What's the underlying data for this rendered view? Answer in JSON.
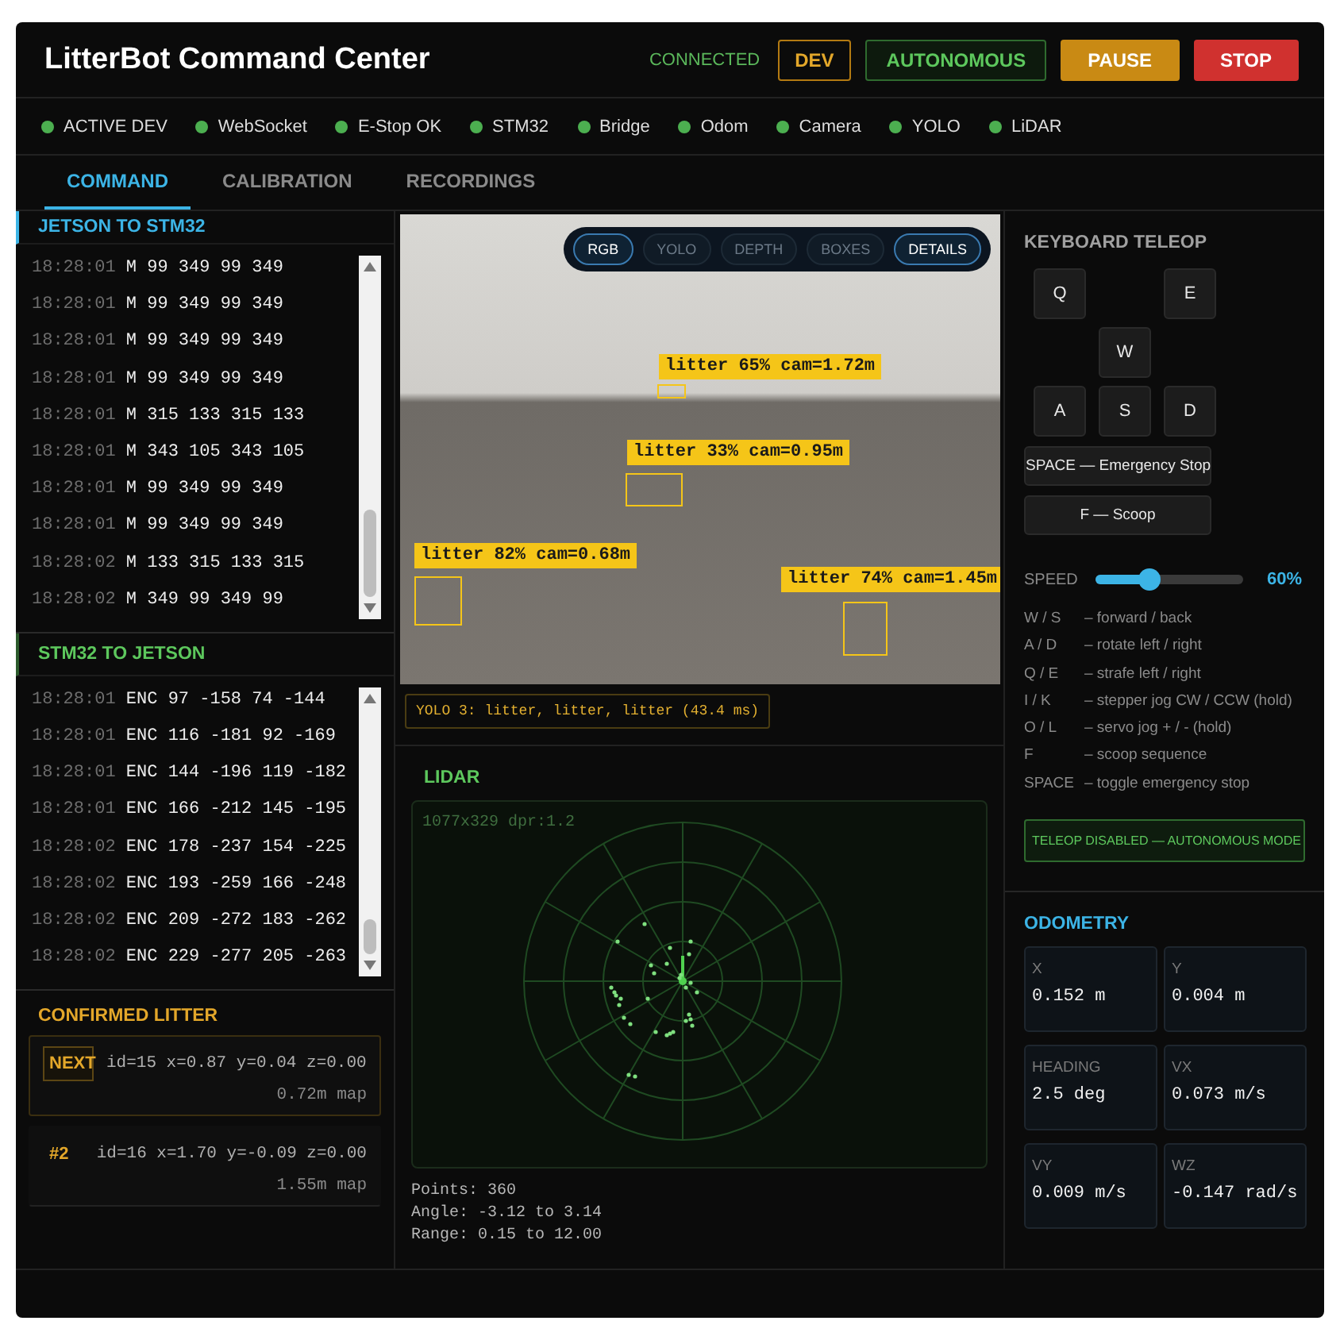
{
  "header": {
    "title": "LitterBot Command Center",
    "connection": "CONNECTED",
    "buttons": [
      {
        "label": "DEV",
        "kind": "outline-amber"
      },
      {
        "label": "AUTONOMOUS",
        "kind": "outline-green"
      },
      {
        "label": "PAUSE",
        "kind": "fill-amber"
      },
      {
        "label": "STOP",
        "kind": "fill-red"
      }
    ]
  },
  "status_bar": [
    {
      "label": "ACTIVE DEV",
      "ok": true
    },
    {
      "label": "WebSocket",
      "ok": true
    },
    {
      "label": "E-Stop OK",
      "ok": true
    },
    {
      "label": "STM32",
      "ok": true
    },
    {
      "label": "Bridge",
      "ok": true
    },
    {
      "label": "Odom",
      "ok": true
    },
    {
      "label": "Camera",
      "ok": true
    },
    {
      "label": "YOLO",
      "ok": true
    },
    {
      "label": "LiDAR",
      "ok": true
    }
  ],
  "tabs": [
    {
      "label": "COMMAND",
      "selected": true
    },
    {
      "label": "CALIBRATION",
      "selected": false
    },
    {
      "label": "RECORDINGS",
      "selected": false
    }
  ],
  "logs": [
    {
      "title": "JETSON TO STM32",
      "kind": "tx",
      "lines": [
        {
          "time": "18:28:01",
          "text": "M 99 349 99 349"
        },
        {
          "time": "18:28:01",
          "text": "M 99 349 99 349"
        },
        {
          "time": "18:28:01",
          "text": "M 99 349 99 349"
        },
        {
          "time": "18:28:01",
          "text": "M 99 349 99 349"
        },
        {
          "time": "18:28:01",
          "text": "M 315 133 315 133"
        },
        {
          "time": "18:28:01",
          "text": "M 343 105 343 105"
        },
        {
          "time": "18:28:01",
          "text": "M 99 349 99 349"
        },
        {
          "time": "18:28:01",
          "text": "M 99 349 99 349"
        },
        {
          "time": "18:28:02",
          "text": "M 133 315 133 315"
        },
        {
          "time": "18:28:02",
          "text": "M 349 99 349 99"
        }
      ]
    },
    {
      "title": "STM32 TO JETSON",
      "kind": "rx",
      "lines": [
        {
          "time": "18:28:01",
          "text": "ENC 97 -158 74 -144"
        },
        {
          "time": "18:28:01",
          "text": "ENC 116 -181 92 -169"
        },
        {
          "time": "18:28:01",
          "text": "ENC 144 -196 119 -182"
        },
        {
          "time": "18:28:01",
          "text": "ENC 166 -212 145 -195"
        },
        {
          "time": "18:28:02",
          "text": "ENC 178 -237 154 -225"
        },
        {
          "time": "18:28:02",
          "text": "ENC 193 -259 166 -248"
        },
        {
          "time": "18:28:02",
          "text": "ENC 209 -272 183 -262"
        },
        {
          "time": "18:28:02",
          "text": "ENC 229 -277 205 -263"
        }
      ]
    }
  ],
  "confirmed_litter": {
    "title": "CONFIRMED LITTER",
    "items": [
      {
        "badge": "NEXT",
        "coords": "id=15 x=0.87 y=0.04 z=0.00",
        "distance": "0.72m map",
        "selected": true
      },
      {
        "badge": "#2",
        "coords": "id=16 x=1.70 y=-0.09 z=0.00",
        "distance": "1.55m map",
        "selected": false
      }
    ]
  },
  "camera": {
    "modes": [
      {
        "label": "RGB",
        "selected": true
      },
      {
        "label": "YOLO",
        "selected": false
      },
      {
        "label": "DEPTH",
        "selected": false
      },
      {
        "label": "BOXES",
        "selected": false
      },
      {
        "label": "DETAILS",
        "selected": true
      }
    ],
    "detections": [
      {
        "label": "litter 65% cam=1.72m"
      },
      {
        "label": "litter 33% cam=0.95m"
      },
      {
        "label": "litter 82% cam=0.68m"
      },
      {
        "label": "litter 74% cam=1.45m"
      }
    ],
    "yolo_summary": "YOLO 3: litter, litter, litter (43.4 ms)"
  },
  "lidar": {
    "title": "LIDAR",
    "canvas_info": "1077x329 dpr:1.2",
    "stats": [
      "Points: 360",
      "Angle: -3.12 to 3.14",
      "Range: 0.15 to 12.00"
    ]
  },
  "teleop": {
    "title": "KEYBOARD TELEOP",
    "keys": [
      "Q",
      "E",
      "W",
      "A",
      "S",
      "D"
    ],
    "wide_keys": [
      "SPACE — Emergency Stop",
      "F — Scoop"
    ],
    "speed": {
      "label": "SPEED",
      "level": 0.37,
      "reading": "60%"
    },
    "help": [
      {
        "keys": "W / S",
        "action": "– forward / back"
      },
      {
        "keys": "A / D",
        "action": "– rotate left / right"
      },
      {
        "keys": "Q / E",
        "action": "– strafe left / right"
      },
      {
        "keys": "I / K",
        "action": "– stepper jog CW / CCW (hold)"
      },
      {
        "keys": "O / L",
        "action": "– servo jog + / - (hold)"
      },
      {
        "keys": "F",
        "action": "– scoop sequence"
      },
      {
        "keys": "SPACE",
        "action": "– toggle emergency stop"
      }
    ],
    "banner": "TELEOP DISABLED — AUTONOMOUS MODE"
  },
  "odometry": {
    "title": "ODOMETRY",
    "cards": [
      {
        "label": "X",
        "value": "0.152 m"
      },
      {
        "label": "Y",
        "value": "0.004 m"
      },
      {
        "label": "HEADING",
        "value": "2.5 deg"
      },
      {
        "label": "VX",
        "value": "0.073 m/s"
      },
      {
        "label": "VY",
        "value": "0.009 m/s"
      },
      {
        "label": "WZ",
        "value": "-0.147 rad/s"
      }
    ]
  }
}
